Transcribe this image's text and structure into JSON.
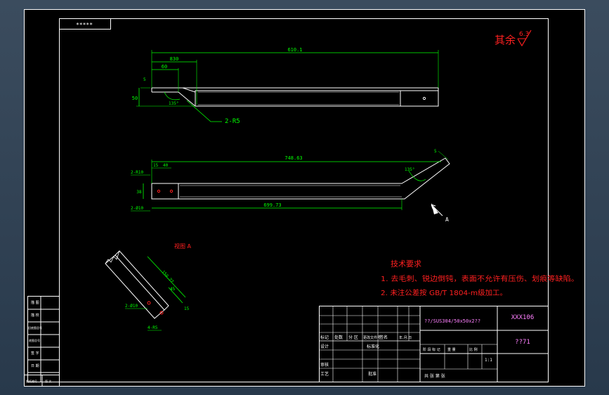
{
  "colors": {
    "background": "#34465a",
    "sheet": "#000000",
    "frame": "#ffffff",
    "dimension": "#00ff00",
    "annotation": "#ff2020",
    "text_white": "#ffffff",
    "title_text": "#ff80ff"
  },
  "corner_label": "*****",
  "surface_finish": {
    "text": "其余",
    "value": "6.3"
  },
  "view1": {
    "dim_total": "610.1",
    "dim_a": "830",
    "dim_b": "60",
    "dim_h": "50",
    "dim_t": "5",
    "angle": "135°",
    "radius_note": "2-R5"
  },
  "view2": {
    "dim_top": "748.63",
    "dim_bottom": "699.73",
    "dim_15": "15",
    "dim_40": "40",
    "dim_h": "38",
    "hole_left_top": "2-R10",
    "hole_left_bottom": "2-Ø10",
    "angle": "135°",
    "dim_5": "5",
    "view_arrow": "A"
  },
  "detail": {
    "title": "视图 A",
    "dim_long": "150.77",
    "dim_45": "45",
    "dim_15": "15",
    "hole_note": "2-Ø10",
    "radius_note": "4-R5"
  },
  "tech_requirements": {
    "title": "技术要求",
    "items": [
      "1. 去毛刺、锐边倒钝，表面不允许有压伤、划痕等缺陷。",
      "2. 未注公差按 GB/T 1804-m级加工。"
    ]
  },
  "title_block": {
    "material": "??/SUS304/50x50x2??",
    "drawing_code": "XXX106",
    "part_name": "??71",
    "header_cells": [
      "标记",
      "处数",
      "分 区",
      "更改文件号",
      "签名",
      "年.月.日"
    ],
    "row_labels": [
      "设计",
      "审核",
      "工艺"
    ],
    "design_col": "标准化",
    "approve": "批准",
    "stage_headers": [
      "阶 段 标 记",
      "重 量",
      "比 例"
    ],
    "scale": "1:1",
    "sheet_info": "共  张  第  张"
  },
  "left_strip": {
    "labels": [
      "描 图",
      "描 校",
      "旧底图总号",
      "底图总号",
      "签 字",
      "日 期"
    ],
    "bottom": [
      "图纸编号",
      "版 次"
    ]
  }
}
